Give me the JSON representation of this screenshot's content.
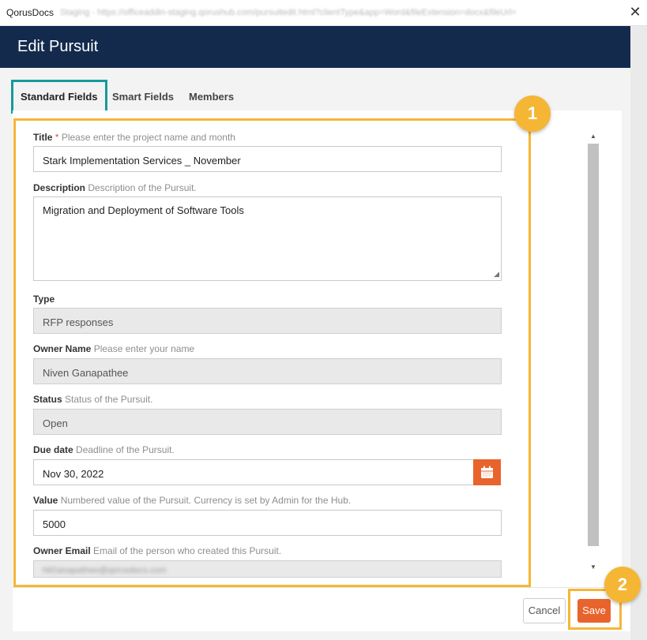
{
  "window": {
    "app_name": "QorusDocs",
    "url": "Staging - https://officeaddin-staging.qorushub.com/pursuitedit.html?clientType&app=Word&fileExtension=docx&fileUrl=",
    "close_glyph": "✕"
  },
  "header": {
    "title": "Edit Pursuit"
  },
  "tabs": [
    {
      "label": "Standard Fields",
      "active": true
    },
    {
      "label": "Smart Fields",
      "active": false
    },
    {
      "label": "Members",
      "active": false
    }
  ],
  "form": {
    "title": {
      "label": "Title",
      "required": "*",
      "hint": "Please enter the project name and month",
      "value": "Stark Implementation Services _ November"
    },
    "description": {
      "label": "Description",
      "hint": "Description of the Pursuit.",
      "value": "Migration and Deployment of Software Tools"
    },
    "type": {
      "label": "Type",
      "value": "RFP responses"
    },
    "owner_name": {
      "label": "Owner Name",
      "hint": "Please enter your name",
      "value": "Niven Ganapathee"
    },
    "status": {
      "label": "Status",
      "hint": "Status of the Pursuit.",
      "value": "Open"
    },
    "due_date": {
      "label": "Due date",
      "hint": "Deadline of the Pursuit.",
      "value": "Nov 30, 2022",
      "icon": "calendar-icon"
    },
    "value": {
      "label": "Value",
      "hint": "Numbered value of the Pursuit. Currency is set by Admin for the Hub.",
      "value": "5000"
    },
    "owner_email": {
      "label": "Owner Email",
      "hint": "Email of the person who created this Pursuit.",
      "value": "NiGanapathee@qorusdocs.com"
    }
  },
  "buttons": {
    "cancel": "Cancel",
    "save": "Save"
  },
  "badges": {
    "step1": "1",
    "step2": "2"
  },
  "colors": {
    "header": "#132a4d",
    "accent": "#e8642c",
    "highlight": "#f5b636",
    "tab_highlight": "#159a9c"
  }
}
